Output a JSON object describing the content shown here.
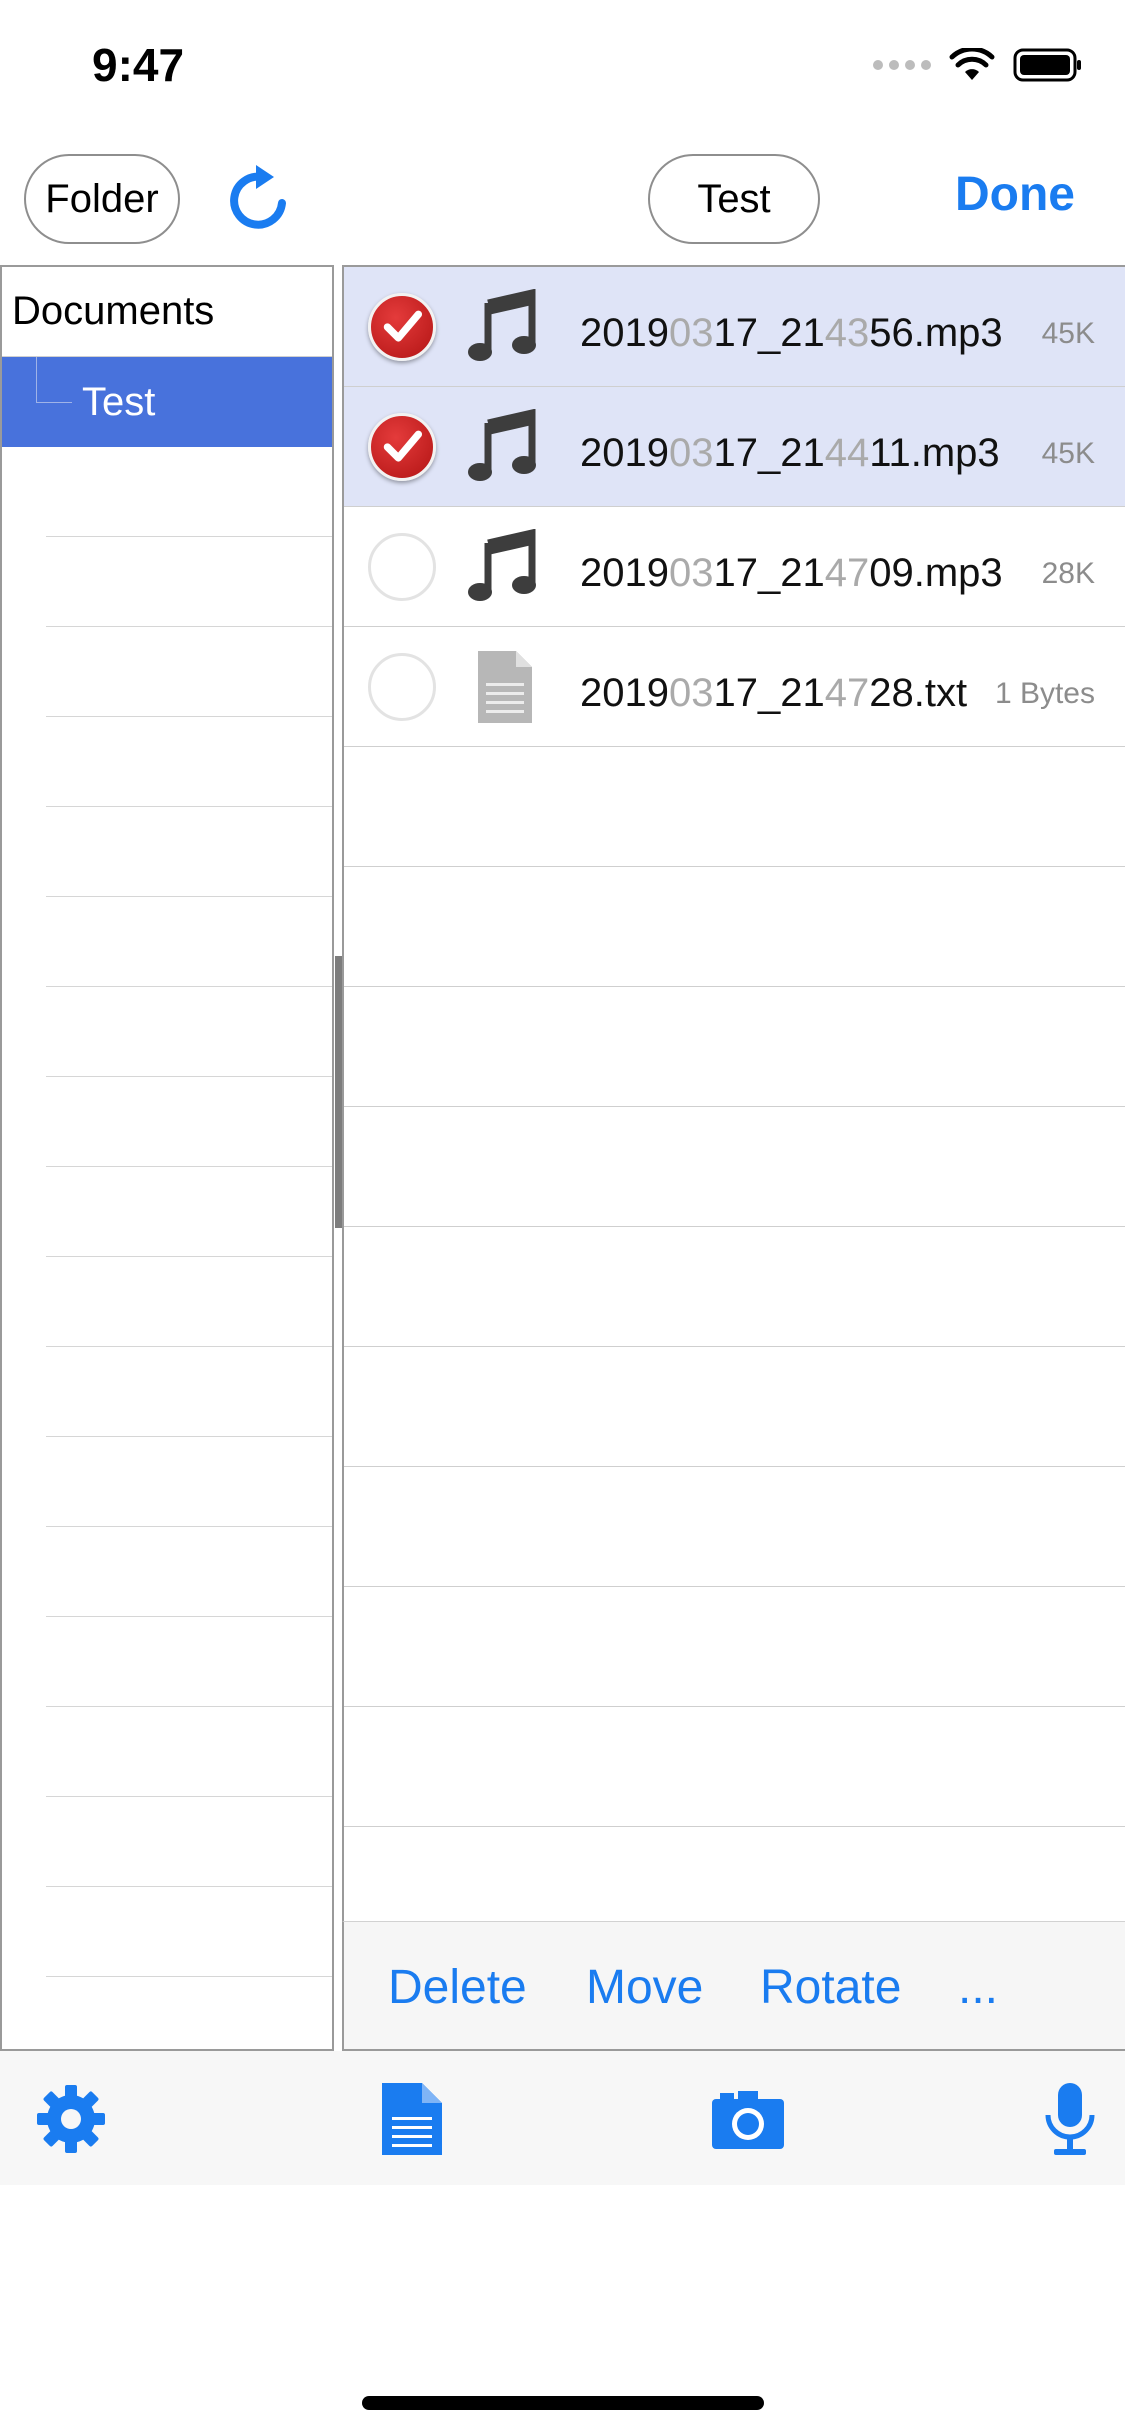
{
  "status_bar": {
    "time": "9:47"
  },
  "nav": {
    "folder_label": "Folder",
    "current_folder_label": "Test",
    "done_label": "Done"
  },
  "folders": {
    "root": "Documents",
    "selected_child": "Test"
  },
  "files": [
    {
      "prefix": "2019",
      "dim1": "03",
      "mid": "17_21",
      "dim2": "43",
      "suffix": "56.mp3",
      "size": "45K",
      "type": "audio",
      "selected": true
    },
    {
      "prefix": "2019",
      "dim1": "03",
      "mid": "17_21",
      "dim2": "44",
      "suffix": "11.mp3",
      "size": "45K",
      "type": "audio",
      "selected": true
    },
    {
      "prefix": "2019",
      "dim1": "03",
      "mid": "17_21",
      "dim2": "47",
      "suffix": "09.mp3",
      "size": "28K",
      "type": "audio",
      "selected": false
    },
    {
      "prefix": "2019",
      "dim1": "03",
      "mid": "17_21",
      "dim2": "47",
      "suffix": "28.txt",
      "size": "1 Bytes",
      "type": "text",
      "selected": false
    }
  ],
  "actions": {
    "delete": "Delete",
    "move": "Move",
    "rotate": "Rotate",
    "more": "..."
  },
  "tabs": {
    "settings": "gear-icon",
    "document": "document-icon",
    "camera": "camera-icon",
    "microphone": "microphone-icon"
  },
  "colors": {
    "accent": "#1a7cf0",
    "selected_folder": "#4872dc",
    "selected_row": "#dfe4f7",
    "check_red": "#c81e1e"
  }
}
